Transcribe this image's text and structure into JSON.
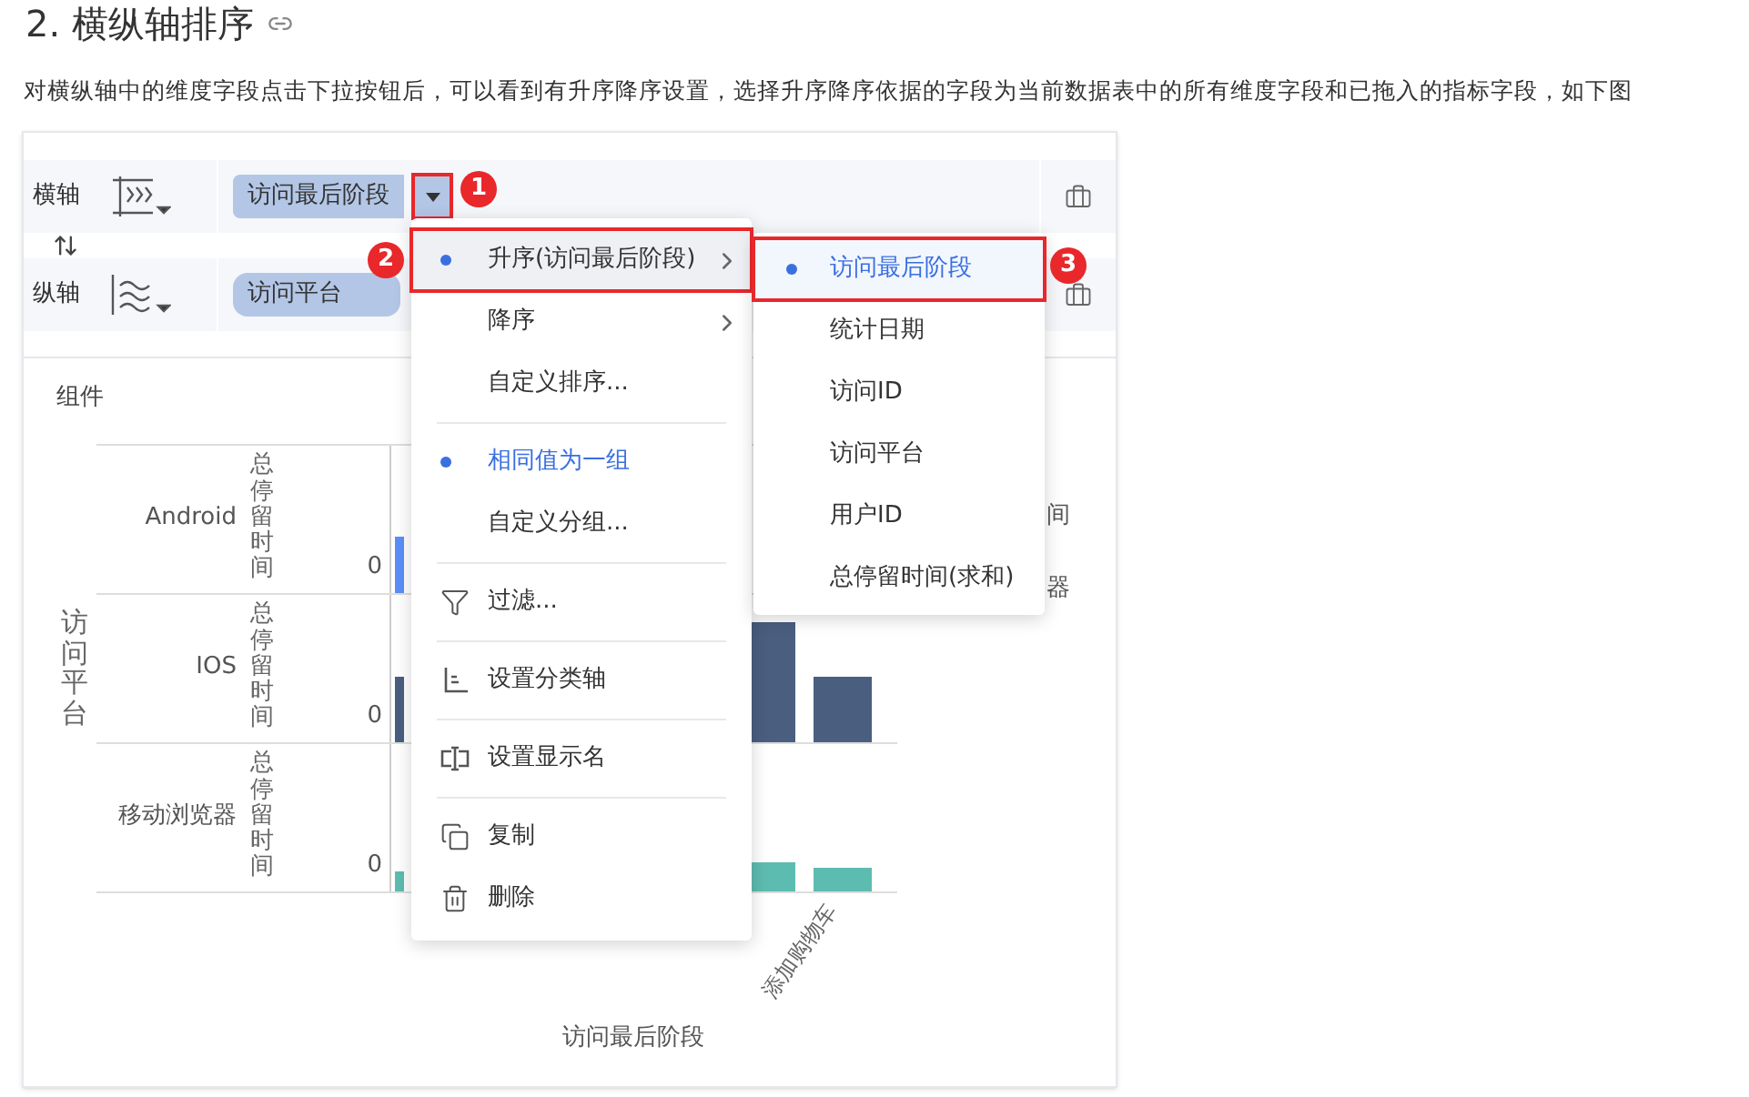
{
  "heading": {
    "title": "2. 横纵轴排序"
  },
  "paragraph": "对横纵轴中的维度字段点击下拉按钮后，可以看到有升序降序设置，选择升序降序依据的字段为当前数据表中的所有维度字段和已拖入的指标字段，如下图",
  "axes": [
    {
      "label": "横轴",
      "field": "访问最后阶段",
      "dropdown": true
    },
    {
      "label": "纵轴",
      "field": "访问平台",
      "dropdown": false
    }
  ],
  "chart": {
    "title": "组件",
    "row_dimension": "访问平台",
    "rows": [
      {
        "label": "Android",
        "measure": "总停留时间",
        "tick": "0"
      },
      {
        "label": "IOS",
        "measure": "总停留时间",
        "tick": "0"
      },
      {
        "label": "移动浏览器",
        "measure": "总停留时间",
        "tick": "0"
      }
    ],
    "x_labels": [
      "添加购物车"
    ],
    "x_title": "访问最后阶段",
    "legend": [
      "间",
      "器"
    ]
  },
  "menu": {
    "groups": [
      [
        {
          "kind": "option",
          "label": "升序(访问最后阶段)",
          "selected": true,
          "hovered": true,
          "submenu": true
        },
        {
          "kind": "option",
          "label": "降序",
          "selected": false,
          "hovered": false,
          "submenu": true
        },
        {
          "kind": "option",
          "label": "自定义排序...",
          "selected": false,
          "hovered": false,
          "submenu": false
        }
      ],
      [
        {
          "kind": "option",
          "label": "相同值为一组",
          "selected": true,
          "hovered": false,
          "submenu": false
        },
        {
          "kind": "option",
          "label": "自定义分组...",
          "selected": false,
          "hovered": false,
          "submenu": false
        }
      ],
      [
        {
          "kind": "action",
          "label": "过滤..."
        }
      ],
      [
        {
          "kind": "action",
          "label": "设置分类轴"
        }
      ],
      [
        {
          "kind": "action",
          "label": "设置显示名"
        }
      ],
      [
        {
          "kind": "action",
          "label": "复制"
        },
        {
          "kind": "action",
          "label": "删除"
        }
      ]
    ]
  },
  "submenu": {
    "items": [
      {
        "label": "访问最后阶段",
        "selected": true
      },
      {
        "label": "统计日期",
        "selected": false
      },
      {
        "label": "访问ID",
        "selected": false
      },
      {
        "label": "访问平台",
        "selected": false
      },
      {
        "label": "用户ID",
        "selected": false
      },
      {
        "label": "总停留时间(求和)",
        "selected": false
      }
    ]
  },
  "callouts": [
    "1",
    "2",
    "3"
  ]
}
